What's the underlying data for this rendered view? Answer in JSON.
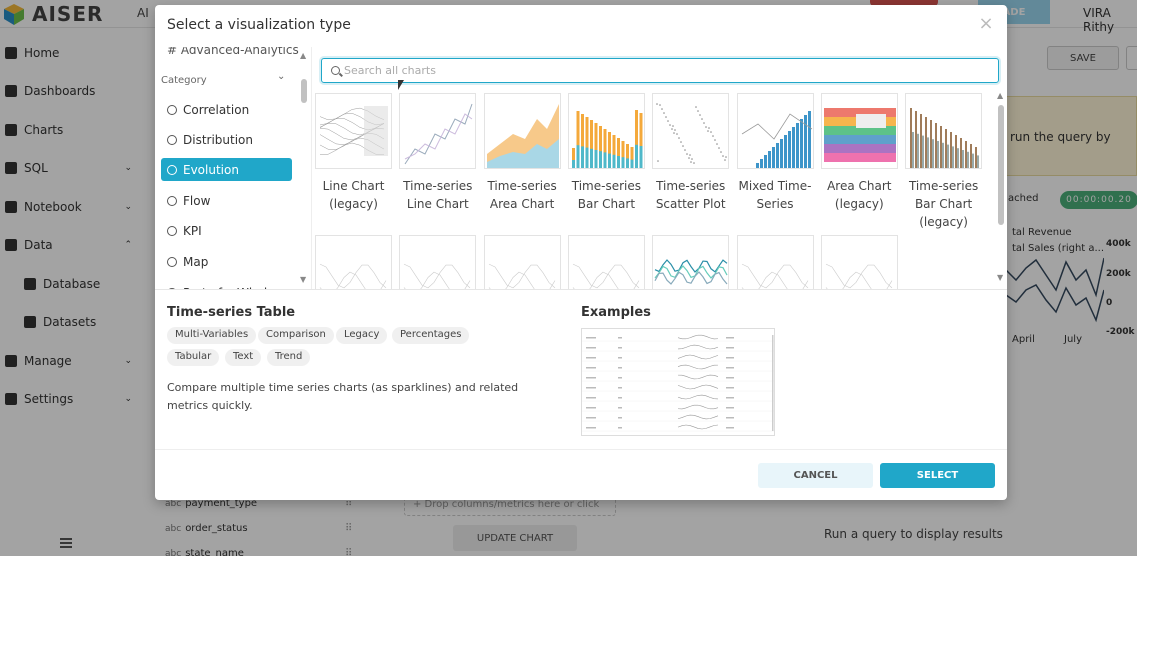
{
  "app": {
    "brand": "AISER",
    "ai_label": "AI",
    "upgrade_label": "ADE",
    "user_name": "VIRA Rithy"
  },
  "sidebar": {
    "items": [
      {
        "label": "Home",
        "icon": "home-icon",
        "chevron": ""
      },
      {
        "label": "Dashboards",
        "icon": "dashboard-icon",
        "chevron": ""
      },
      {
        "label": "Charts",
        "icon": "chart-icon",
        "chevron": ""
      },
      {
        "label": "SQL",
        "icon": "flask-icon",
        "chevron": "⌄"
      },
      {
        "label": "Notebook",
        "icon": "notebook-icon",
        "chevron": "⌄"
      },
      {
        "label": "Data",
        "icon": "database-icon",
        "chevron": "⌃"
      },
      {
        "label": "Database",
        "icon": "database-icon",
        "chevron": ""
      },
      {
        "label": "Datasets",
        "icon": "table-icon",
        "chevron": ""
      },
      {
        "label": "Manage",
        "icon": "puzzle-icon",
        "chevron": "⌄"
      },
      {
        "label": "Settings",
        "icon": "gear-icon",
        "chevron": "⌄"
      }
    ]
  },
  "background": {
    "save_label": "SAVE",
    "warning_text": "run the query by",
    "cached_label": "ached",
    "timer": "00:00:00.20",
    "legend": [
      "tal Revenue",
      "tal Sales (right a..."
    ],
    "y_ticks": [
      "400k",
      "200k",
      "0",
      "-200k"
    ],
    "x_ticks": [
      "April",
      "July"
    ],
    "fields": [
      {
        "type": "abc",
        "name": "payment_type"
      },
      {
        "type": "abc",
        "name": "order_status"
      },
      {
        "type": "abc",
        "name": "state_name"
      }
    ],
    "drop_placeholder": "+ Drop columns/metrics here or click",
    "update_label": "UPDATE CHART",
    "run_hint": "Run a query to display results"
  },
  "modal": {
    "title": "Select a visualization type",
    "close_icon": "close-icon",
    "left_panel": {
      "top_item": "Advanced-Analytics",
      "category_header": "Category",
      "categories": [
        "Correlation",
        "Distribution",
        "Evolution",
        "Flow",
        "KPI",
        "Map",
        "Part of a Whole"
      ],
      "active_category": "Evolution"
    },
    "search": {
      "placeholder": "Search all charts",
      "value": ""
    },
    "charts": [
      {
        "label": "Line Chart (legacy)",
        "thumb": "line-legacy"
      },
      {
        "label": "Time-series Line Chart",
        "thumb": "ts-line"
      },
      {
        "label": "Time-series Area Chart",
        "thumb": "ts-area"
      },
      {
        "label": "Time-series Bar Chart",
        "thumb": "ts-bar"
      },
      {
        "label": "Time-series Scatter Plot",
        "thumb": "ts-scatter"
      },
      {
        "label": "Mixed Time-Series",
        "thumb": "mixed"
      },
      {
        "label": "Area Chart (legacy)",
        "thumb": "area-legacy"
      },
      {
        "label": "Time-series Bar Chart (legacy)",
        "thumb": "bar-legacy"
      },
      {
        "label": "",
        "thumb": "r2-1"
      },
      {
        "label": "",
        "thumb": "r2-2"
      },
      {
        "label": "",
        "thumb": "r2-3"
      },
      {
        "label": "",
        "thumb": "r2-4"
      },
      {
        "label": "",
        "thumb": "r2-5"
      },
      {
        "label": "",
        "thumb": "r2-6"
      },
      {
        "label": "",
        "thumb": "r2-7"
      }
    ],
    "details": {
      "title": "Time-series Table",
      "tags": [
        "Multi-Variables",
        "Comparison",
        "Legacy",
        "Percentages",
        "Tabular",
        "Text",
        "Trend"
      ],
      "description": "Compare multiple time series charts (as sparklines) and related metrics quickly.",
      "examples_label": "Examples"
    },
    "buttons": {
      "cancel": "CANCEL",
      "select": "SELECT"
    }
  },
  "colors": {
    "accent": "#20a7c9",
    "overlay": "rgba(0,0,0,0.36)",
    "bar_orange": "#f4a93b",
    "bar_teal": "#4fb8c9",
    "area_peach": "#f7c98a",
    "area_blue": "#a9d7e6"
  }
}
